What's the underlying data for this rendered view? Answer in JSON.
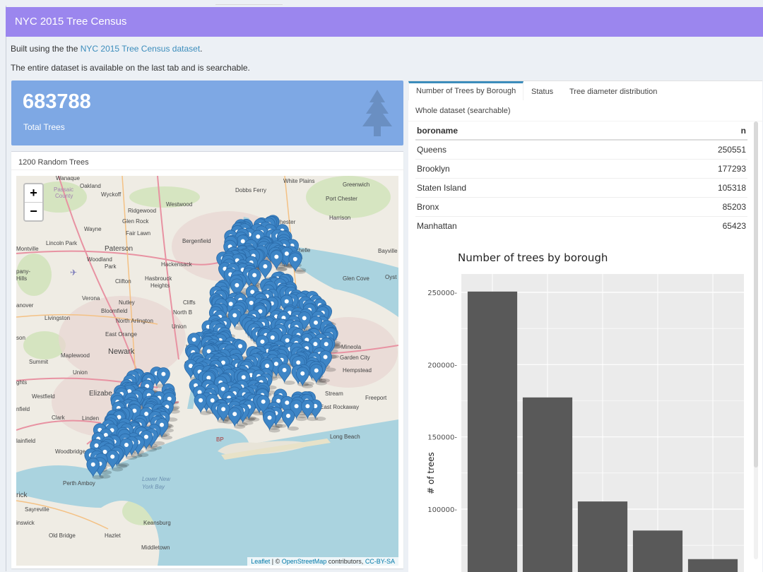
{
  "app": {
    "title": "NYC 2015 Tree Census",
    "accent_color": "#9b86ee"
  },
  "intro": {
    "line1_prefix": "Built using the the ",
    "line1_link": "NYC 2015 Tree Census dataset",
    "line1_suffix": ".",
    "line2": "The entire dataset is available on the last tab and is searchable."
  },
  "valuebox": {
    "value": "683788",
    "label": "Total Trees",
    "icon": "tree-icon",
    "color": "#7ea8e4"
  },
  "map_panel": {
    "title": "1200 Random Trees",
    "zoom_in": "+",
    "zoom_out": "−",
    "attribution_leaflet": "Leaflet",
    "attribution_sep": " | © ",
    "attribution_osm": "OpenStreetMap",
    "attribution_mid": " contributors, ",
    "attribution_license": "CC-BY-SA",
    "place_labels": [
      "Wanaque",
      "Oakland",
      "Wyckoff",
      "Dobbs Ferry",
      "White Plains",
      "Greenwich",
      "Passaic County",
      "Port Chester",
      "Ridgewood",
      "Westwood",
      "Glen Rock",
      "Harrison",
      "Eastchester",
      "Wayne",
      "Fair Lawn",
      "Bergenfield",
      "Yonkers",
      "New Rochelle",
      "Montville",
      "Lincoln Park",
      "Paterson",
      "Bayville",
      "Woodland Park",
      "Hackensack",
      "Hasbrouck Heights",
      "Clifton",
      "Glen Cove",
      "Oyster Bay",
      "Verona",
      "Nutley",
      "Cliffside",
      "Bloomfield",
      "North Bergen",
      "Livingston",
      "North Arlington",
      "Union City",
      "East Orange",
      "Newark",
      "Hoboken",
      "Mineola",
      "Maplewood",
      "New York",
      "Garden City",
      "Summit",
      "Union",
      "Hempstead",
      "Westfield",
      "Elizabeth",
      "Stream",
      "Freeport",
      "Clark",
      "Linden",
      "East Rockaway",
      "Long Beach",
      "Plainfield",
      "Woodbridge",
      "Perth Amboy",
      "Lower New York Bay",
      "Sayreville",
      "Keansburg",
      "Old Bridge",
      "Hazlet",
      "Middletown",
      "Brunswick"
    ]
  },
  "tabs": [
    {
      "label": "Number of Trees by Borough",
      "active": true
    },
    {
      "label": "Status",
      "active": false
    },
    {
      "label": "Tree diameter distribution",
      "active": false
    },
    {
      "label": "Whole dataset (searchable)",
      "active": false
    }
  ],
  "table": {
    "columns": [
      "boroname",
      "n"
    ],
    "rows": [
      [
        "Queens",
        "250551"
      ],
      [
        "Brooklyn",
        "177293"
      ],
      [
        "Staten Island",
        "105318"
      ],
      [
        "Bronx",
        "85203"
      ],
      [
        "Manhattan",
        "65423"
      ]
    ]
  },
  "chart_data": {
    "type": "bar",
    "title": "Number of trees by borough",
    "ylabel": "# of trees",
    "xlabel": "",
    "categories": [
      "Queens",
      "Brooklyn",
      "Staten Island",
      "Bronx",
      "Manhattan"
    ],
    "values": [
      250551,
      177293,
      105318,
      85203,
      65423
    ],
    "y_ticks": [
      100000,
      150000,
      200000,
      250000
    ],
    "ylim_visible": [
      60000,
      265000
    ],
    "grid": true,
    "bar_color": "#595959",
    "panel_color": "#ebebeb"
  }
}
